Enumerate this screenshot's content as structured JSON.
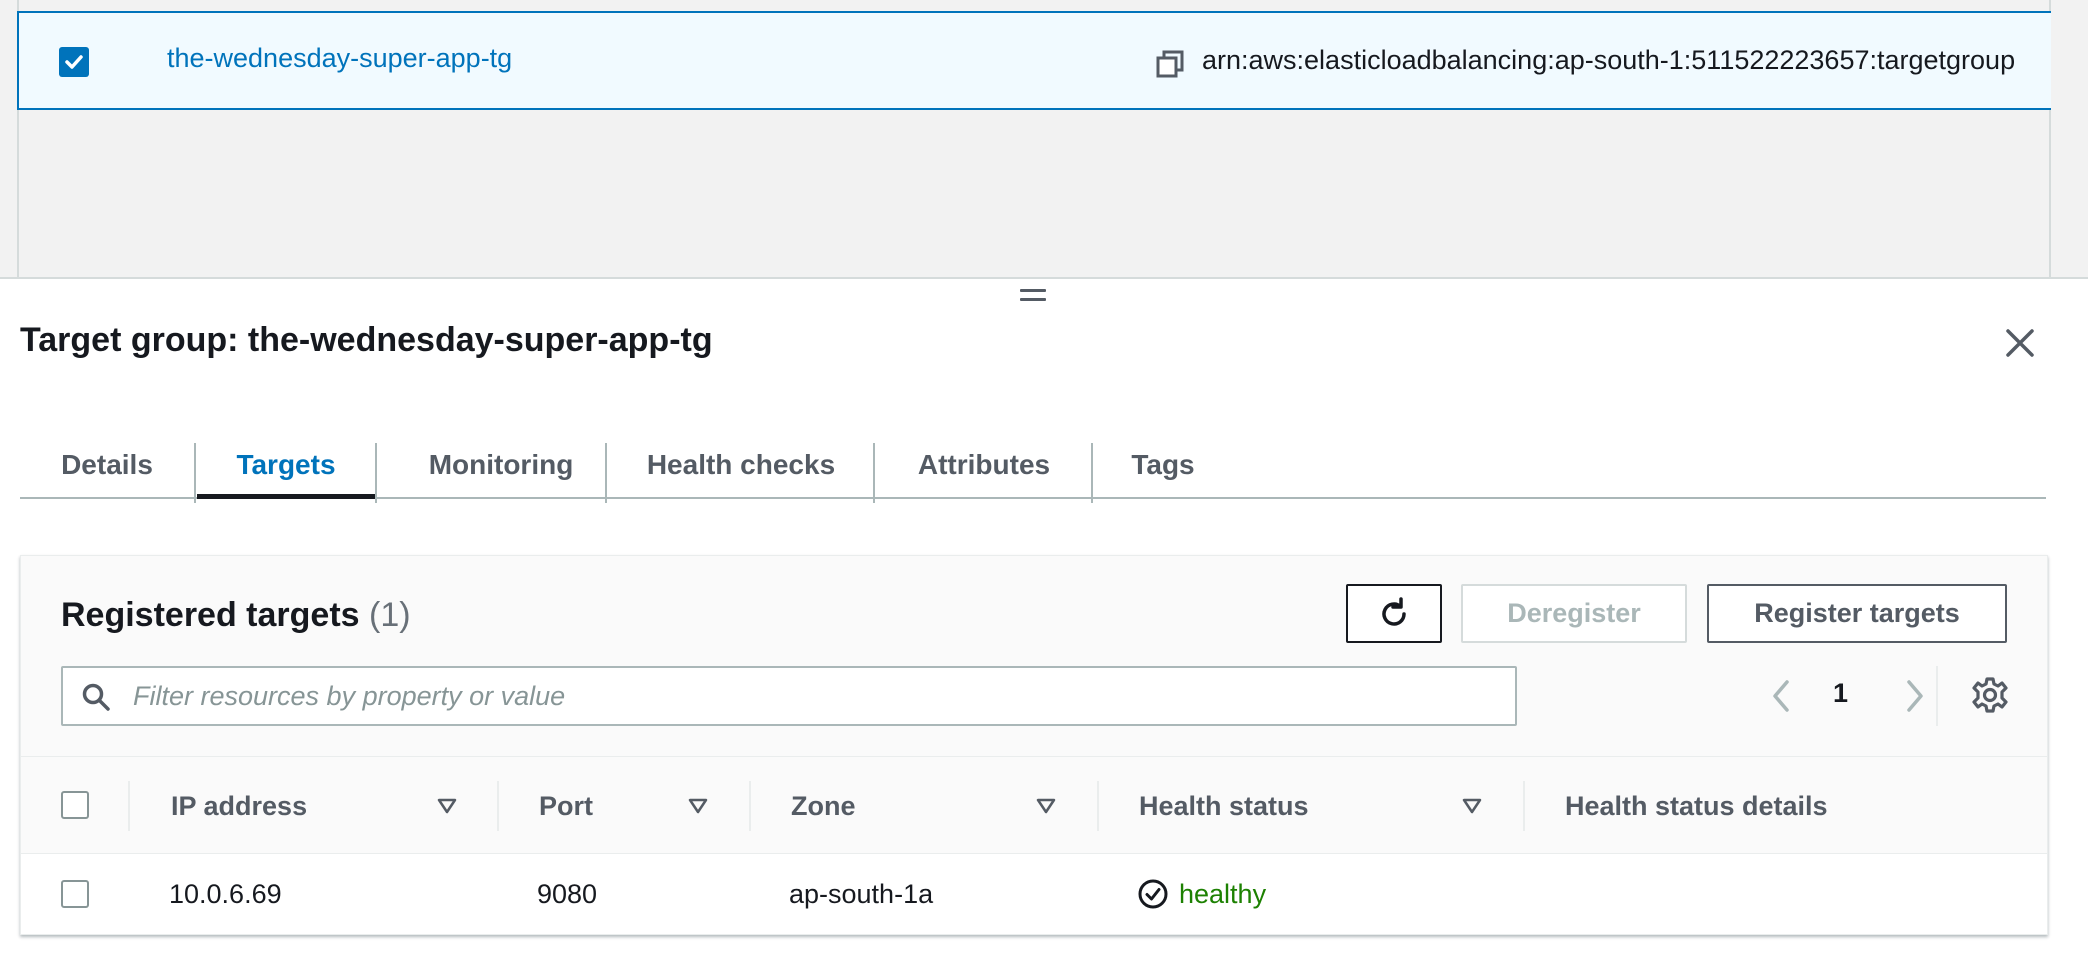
{
  "list": {
    "selected_row": {
      "name": "the-wednesday-super-app-tg",
      "arn": "arn:aws:elasticloadbalancing:ap-south-1:511522223657:targetgroup"
    }
  },
  "split_panel": {
    "title": "Target group: the-wednesday-super-app-tg",
    "tabs": [
      {
        "label": "Details"
      },
      {
        "label": "Targets"
      },
      {
        "label": "Monitoring"
      },
      {
        "label": "Health checks"
      },
      {
        "label": "Attributes"
      },
      {
        "label": "Tags"
      }
    ],
    "active_tab": "Targets"
  },
  "targets": {
    "title": "Registered targets",
    "count": "(1)",
    "deregister_label": "Deregister",
    "register_label": "Register targets",
    "filter_placeholder": "Filter resources by property or value",
    "current_page": "1",
    "columns": [
      {
        "label": "IP address"
      },
      {
        "label": "Port"
      },
      {
        "label": "Zone"
      },
      {
        "label": "Health status"
      },
      {
        "label": "Health status details"
      }
    ],
    "rows": [
      {
        "ip": "10.0.6.69",
        "port": "9080",
        "zone": "ap-south-1a",
        "health": "healthy",
        "health_details": ""
      }
    ]
  },
  "colors": {
    "link": "#0073bb",
    "healthy": "#1d8102",
    "selected_row_bg": "#f1faff"
  }
}
